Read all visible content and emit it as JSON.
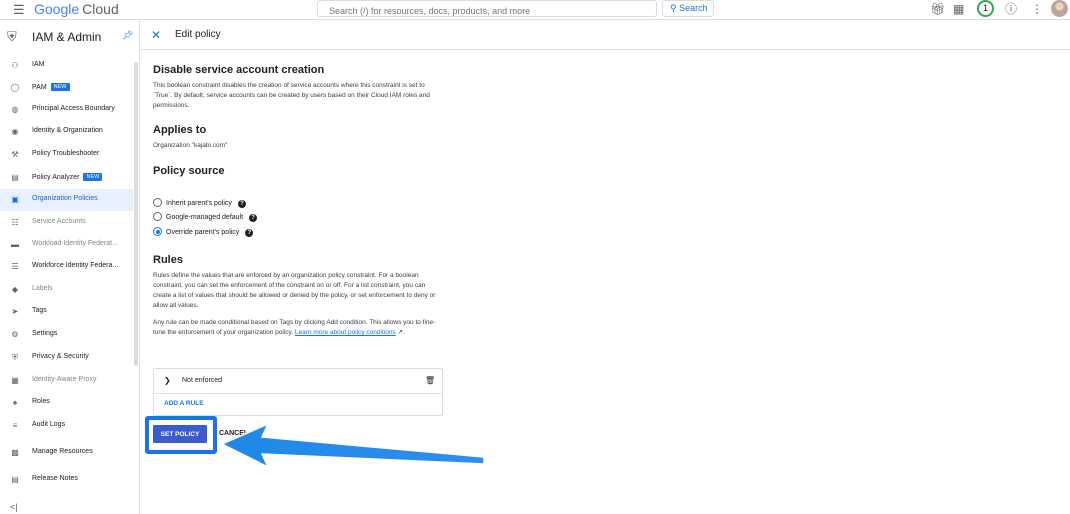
{
  "topbar": {
    "logo_google": "Google",
    "logo_cloud": "Cloud",
    "search_placeholder": "Search (/) for resources, docs, products, and more",
    "search_button": "Search",
    "notifications_count": "1"
  },
  "sidebar": {
    "title": "IAM & Admin",
    "items": [
      {
        "label": "IAM",
        "icon": "person-add-icon"
      },
      {
        "label": "PAM",
        "badge": "NEW",
        "icon": "lock-icon"
      },
      {
        "label": "Principal Access Boundary",
        "icon": "boundary-icon"
      },
      {
        "label": "Identity & Organization",
        "icon": "account-circle-icon"
      },
      {
        "label": "Policy Troubleshooter",
        "icon": "wrench-icon"
      },
      {
        "label": "Policy Analyzer",
        "badge": "NEW",
        "icon": "analyzer-icon"
      },
      {
        "label": "Organization Policies",
        "icon": "document-icon"
      },
      {
        "label": "Service Accounts",
        "icon": "service-account-icon"
      },
      {
        "label": "Workload Identity Federat...",
        "icon": "id-card-icon"
      },
      {
        "label": "Workforce Identity Federa...",
        "icon": "list-icon"
      },
      {
        "label": "Labels",
        "icon": "label-icon"
      },
      {
        "label": "Tags",
        "icon": "tag-icon"
      },
      {
        "label": "Settings",
        "icon": "gear-icon"
      },
      {
        "label": "Privacy & Security",
        "icon": "shield-icon"
      },
      {
        "label": "Identity-Aware Proxy",
        "icon": "proxy-icon"
      },
      {
        "label": "Roles",
        "icon": "roles-icon"
      },
      {
        "label": "Audit Logs",
        "icon": "logs-icon"
      },
      {
        "label": "Manage Resources",
        "icon": "folder-icon"
      },
      {
        "label": "Release Notes",
        "icon": "notes-icon"
      }
    ]
  },
  "header": {
    "title": "Edit policy"
  },
  "policy": {
    "title": "Disable service account creation",
    "description": "This boolean constraint disables the creation of service accounts where this constraint is set to `True`. By default, service accounts can be created by users based on their Cloud IAM roles and permissions.",
    "applies_to_title": "Applies to",
    "applies_to_value": "Organization \"kajabi.com\"",
    "source_title": "Policy source",
    "source_options": [
      {
        "label": "Inherit parent's policy",
        "selected": false
      },
      {
        "label": "Google-managed default",
        "selected": false
      },
      {
        "label": "Override parent's policy",
        "selected": true
      }
    ],
    "rules_title": "Rules",
    "rules_text_1": "Rules define the values that are enforced by an organization policy constraint. For a boolean constraint, you can set the enforcement of the constraint on or off. For a list constraint, you can create a list of values that should be allowed or denied by the policy, or set enforcement to deny or allow all values.",
    "rules_text_2a": "Any rule can be made conditional based on Tags by clicking Add condition. This allows you to fine-tune the enforcement of your organization policy. ",
    "rules_text_2_link": "Learn more about policy conditions",
    "rule_label": "Not enforced",
    "add_rule": "ADD A RULE",
    "set_policy": "SET POLICY",
    "cancel": "CANCEL"
  },
  "colors": {
    "accent": "#1a73e8",
    "button": "#3b5ccf",
    "arrow": "#2f8ef0"
  }
}
